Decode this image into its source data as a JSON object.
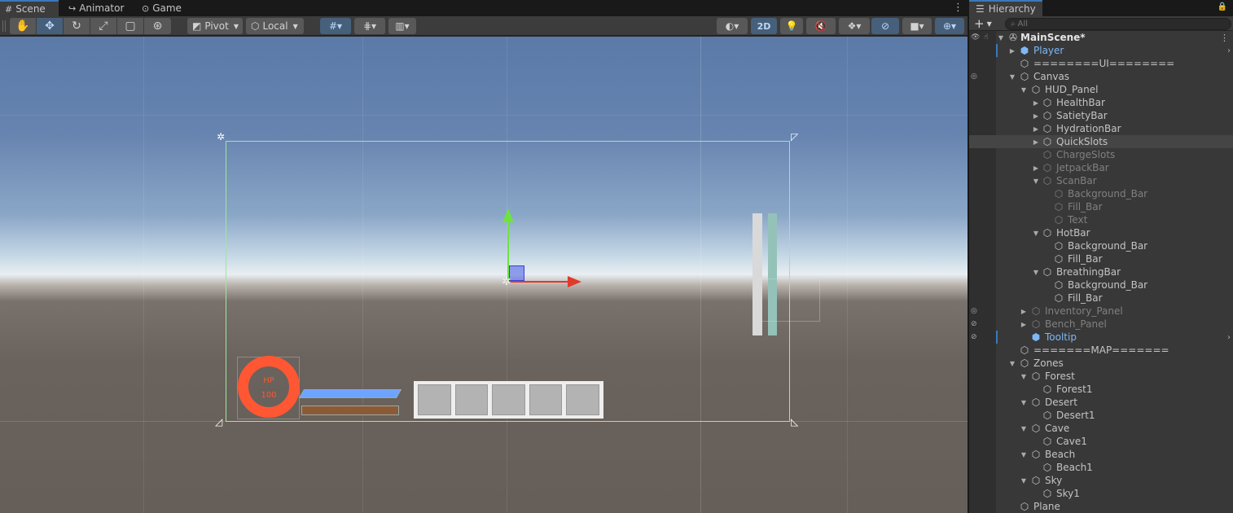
{
  "scene_window": {
    "tabs": [
      {
        "label": "Scene",
        "icon": "grid-icon"
      },
      {
        "label": "Animator",
        "icon": "animator-icon"
      },
      {
        "label": "Game",
        "icon": "gamepad-icon"
      }
    ],
    "toolbar": {
      "pivot_label": "Pivot",
      "space_label": "Local",
      "toggle_2d_label": "2D"
    },
    "hud": {
      "hp_label": "HP",
      "hp_value": "100"
    }
  },
  "hierarchy": {
    "tab_label": "Hierarchy",
    "search_placeholder": "All",
    "scene_name": "MainScene*",
    "items": [
      {
        "label": "Player"
      },
      {
        "label": "========UI========"
      },
      {
        "label": "Canvas"
      },
      {
        "label": "HUD_Panel"
      },
      {
        "label": "HealthBar"
      },
      {
        "label": "SatietyBar"
      },
      {
        "label": "HydrationBar"
      },
      {
        "label": "QuickSlots"
      },
      {
        "label": "ChargeSlots"
      },
      {
        "label": "JetpackBar"
      },
      {
        "label": "ScanBar"
      },
      {
        "label": "Background_Bar"
      },
      {
        "label": "Fill_Bar"
      },
      {
        "label": "Text"
      },
      {
        "label": "HotBar"
      },
      {
        "label": "Background_Bar"
      },
      {
        "label": "Fill_Bar"
      },
      {
        "label": "BreathingBar"
      },
      {
        "label": "Background_Bar"
      },
      {
        "label": "Fill_Bar"
      },
      {
        "label": "Inventory_Panel"
      },
      {
        "label": "Bench_Panel"
      },
      {
        "label": "Tooltip"
      },
      {
        "label": "=======MAP======="
      },
      {
        "label": "Zones"
      },
      {
        "label": "Forest"
      },
      {
        "label": "Forest1"
      },
      {
        "label": "Desert"
      },
      {
        "label": "Desert1"
      },
      {
        "label": "Cave"
      },
      {
        "label": "Cave1"
      },
      {
        "label": "Beach"
      },
      {
        "label": "Beach1"
      },
      {
        "label": "Sky"
      },
      {
        "label": "Sky1"
      },
      {
        "label": "Plane"
      }
    ]
  },
  "colors": {
    "accent": "#3a79bb",
    "prefab_text": "#7fb7f5",
    "hp_ring": "#ff5733",
    "canvas_outline": "#9ce89a"
  }
}
